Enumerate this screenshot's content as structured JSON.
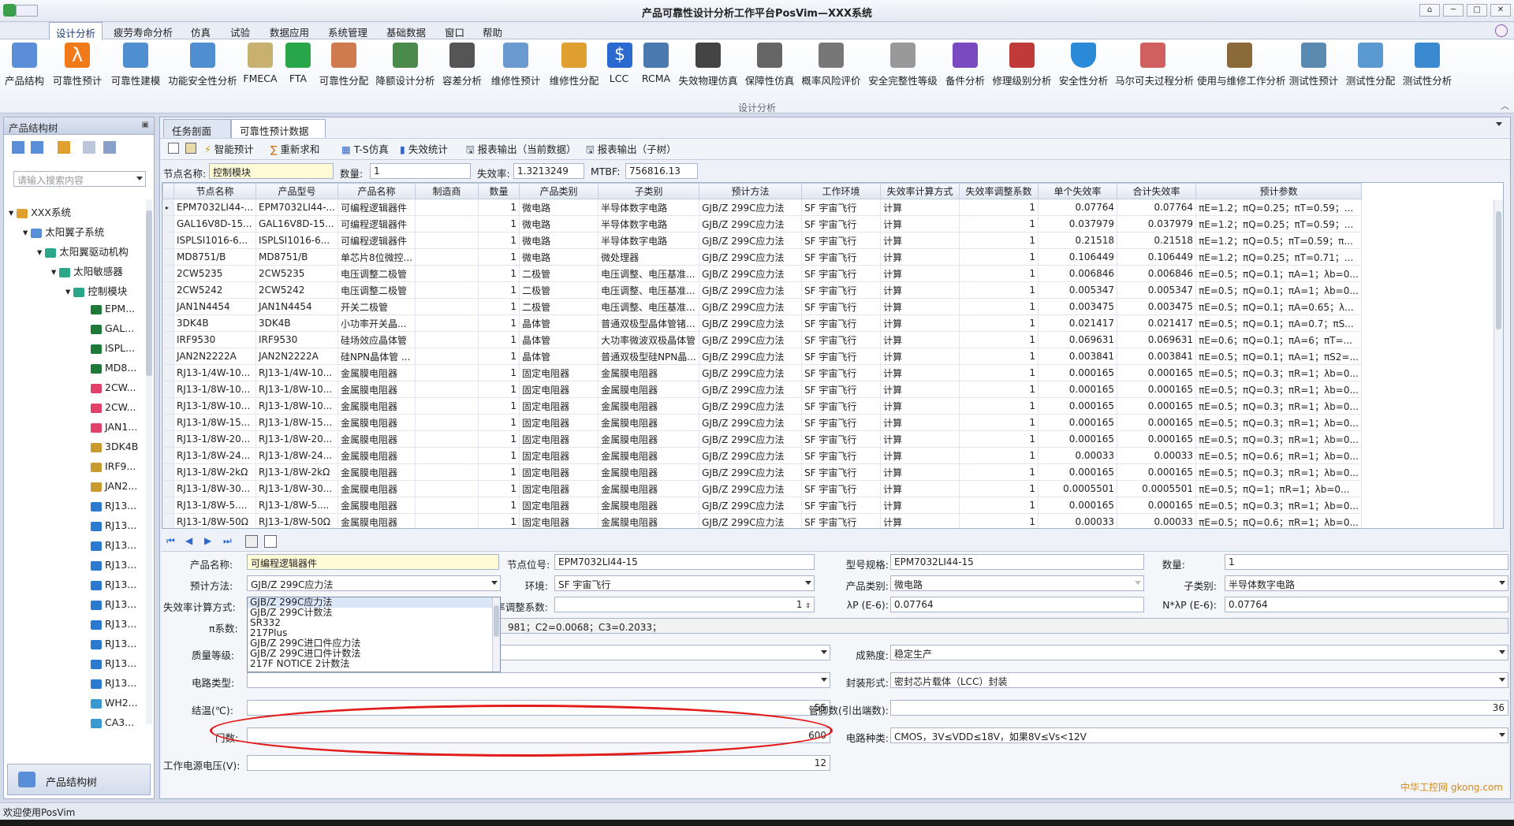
{
  "window": {
    "title": "产品可靠性设计分析工作平台PosVim—XXX系统"
  },
  "menu": [
    "设计分析",
    "疲劳寿命分析",
    "仿真",
    "试验",
    "数据应用",
    "系统管理",
    "基础数据",
    "窗口",
    "帮助"
  ],
  "ribbon": {
    "group": "设计分析",
    "buttons": [
      "产品结构",
      "可靠性预计",
      "可靠性建模",
      "功能安全性分析",
      "FMECA",
      "FTA",
      "可靠性分配",
      "降额设计分析",
      "容差分析",
      "维修性预计",
      "维修性分配",
      "LCC",
      "RCMA",
      "失效物理仿真",
      "保障性仿真",
      "概率风险评价",
      "安全完整性等级",
      "备件分析",
      "修理级别分析",
      "安全性分析",
      "马尔可夫过程分析",
      "使用与维修工作分析",
      "测试性预计",
      "测试性分配",
      "测试性分析"
    ]
  },
  "left_panel": {
    "title": "产品结构树",
    "search_placeholder": "请输入搜索内容",
    "tree": [
      "XXX系统",
      "太阳翼子系统",
      "太阳翼驱动机构",
      "太阳敏感器",
      "控制模块",
      "EPM...",
      "GAL...",
      "ISPL...",
      "MD8...",
      "2CW...",
      "2CW...",
      "JAN1...",
      "3DK4B",
      "IRF9...",
      "JAN2...",
      "RJ13...",
      "RJ13...",
      "RJ13...",
      "RJ13...",
      "RJ13...",
      "RJ13...",
      "RJ13...",
      "RJ13...",
      "RJ13...",
      "RJ13...",
      "WH2...",
      "CA3..."
    ],
    "footer": "产品结构树"
  },
  "tabs": [
    "任务剖面",
    "可靠性预计数据"
  ],
  "toolbar": [
    "智能预计",
    "重新求和",
    "T-S仿真",
    "失效统计",
    "报表输出（当前数据）",
    "报表输出（子树）"
  ],
  "summary": {
    "node_label": "节点名称:",
    "node_value": "控制模块",
    "qty_label": "数量:",
    "qty_value": "1",
    "rate_label": "失效率:",
    "rate_value": "1.3213249",
    "mtbf_label": "MTBF:",
    "mtbf_value": "756816.13"
  },
  "grid": {
    "columns": [
      "节点名称",
      "产品型号",
      "产品名称",
      "制造商",
      "数量",
      "产品类别",
      "子类别",
      "预计方法",
      "工作环境",
      "失效率计算方式",
      "失效率调整系数",
      "单个失效率",
      "合计失效率",
      "预计参数"
    ],
    "rows": [
      [
        "EPM7032LI44-...",
        "EPM7032LI44-...",
        "可编程逻辑器件",
        "",
        "1",
        "微电路",
        "半导体数字电路",
        "GJB/Z 299C应力法",
        "SF 宇宙飞行",
        "计算",
        "1",
        "0.07764",
        "0.07764",
        "πE=1.2；πQ=0.25；πT=0.59；..."
      ],
      [
        "GAL16V8D-15...",
        "GAL16V8D-15...",
        "可编程逻辑器件",
        "",
        "1",
        "微电路",
        "半导体数字电路",
        "GJB/Z 299C应力法",
        "SF 宇宙飞行",
        "计算",
        "1",
        "0.037979",
        "0.037979",
        "πE=1.2；πQ=0.25；πT=0.59；..."
      ],
      [
        "ISPLSI1016-6...",
        "ISPLSI1016-6...",
        "可编程逻辑器件",
        "",
        "1",
        "微电路",
        "半导体数字电路",
        "GJB/Z 299C应力法",
        "SF 宇宙飞行",
        "计算",
        "1",
        "0.21518",
        "0.21518",
        "πE=1.2；πQ=0.5；πT=0.59；π..."
      ],
      [
        "MD8751/B",
        "MD8751/B",
        "单芯片8位微控...",
        "",
        "1",
        "微电路",
        "微处理器",
        "GJB/Z 299C应力法",
        "SF 宇宙飞行",
        "计算",
        "1",
        "0.106449",
        "0.106449",
        "πE=1.2；πQ=0.25；πT=0.71；..."
      ],
      [
        "2CW5235",
        "2CW5235",
        "电压调整二极管",
        "",
        "1",
        "二极管",
        "电压调整、电压基准...",
        "GJB/Z 299C应力法",
        "SF 宇宙飞行",
        "计算",
        "1",
        "0.006846",
        "0.006846",
        "πE=0.5；πQ=0.1；πA=1；λb=0..."
      ],
      [
        "2CW5242",
        "2CW5242",
        "电压调整二极管",
        "",
        "1",
        "二极管",
        "电压调整、电压基准...",
        "GJB/Z 299C应力法",
        "SF 宇宙飞行",
        "计算",
        "1",
        "0.005347",
        "0.005347",
        "πE=0.5；πQ=0.1；πA=1；λb=0..."
      ],
      [
        "JAN1N4454",
        "JAN1N4454",
        "开关二极管",
        "",
        "1",
        "二极管",
        "电压调整、电压基准...",
        "GJB/Z 299C应力法",
        "SF 宇宙飞行",
        "计算",
        "1",
        "0.003475",
        "0.003475",
        "πE=0.5；πQ=0.1；πA=0.65；λ..."
      ],
      [
        "3DK4B",
        "3DK4B",
        "小功率开关晶...",
        "",
        "1",
        "晶体管",
        "普通双极型晶体管锗...",
        "GJB/Z 299C应力法",
        "SF 宇宙飞行",
        "计算",
        "1",
        "0.021417",
        "0.021417",
        "πE=0.5；πQ=0.1；πA=0.7；πS..."
      ],
      [
        "IRF9530",
        "IRF9530",
        "硅场效应晶体管",
        "",
        "1",
        "晶体管",
        "大功率微波双极晶体管",
        "GJB/Z 299C应力法",
        "SF 宇宙飞行",
        "计算",
        "1",
        "0.069631",
        "0.069631",
        "πE=0.6；πQ=0.1；πA=6；πT=..."
      ],
      [
        "JAN2N2222A",
        "JAN2N2222A",
        "硅NPN晶体管 ...",
        "",
        "1",
        "晶体管",
        "普通双极型硅NPN晶...",
        "GJB/Z 299C应力法",
        "SF 宇宙飞行",
        "计算",
        "1",
        "0.003841",
        "0.003841",
        "πE=0.5；πQ=0.1；πA=1；πS2=..."
      ],
      [
        "RJ13-1/4W-10...",
        "RJ13-1/4W-10...",
        "金属膜电阻器",
        "",
        "1",
        "固定电阻器",
        "金属膜电阻器",
        "GJB/Z 299C应力法",
        "SF 宇宙飞行",
        "计算",
        "1",
        "0.000165",
        "0.000165",
        "πE=0.5；πQ=0.3；πR=1；λb=0..."
      ],
      [
        "RJ13-1/8W-10...",
        "RJ13-1/8W-10...",
        "金属膜电阻器",
        "",
        "1",
        "固定电阻器",
        "金属膜电阻器",
        "GJB/Z 299C应力法",
        "SF 宇宙飞行",
        "计算",
        "1",
        "0.000165",
        "0.000165",
        "πE=0.5；πQ=0.3；πR=1；λb=0..."
      ],
      [
        "RJ13-1/8W-10...",
        "RJ13-1/8W-10...",
        "金属膜电阻器",
        "",
        "1",
        "固定电阻器",
        "金属膜电阻器",
        "GJB/Z 299C应力法",
        "SF 宇宙飞行",
        "计算",
        "1",
        "0.000165",
        "0.000165",
        "πE=0.5；πQ=0.3；πR=1；λb=0..."
      ],
      [
        "RJ13-1/8W-15...",
        "RJ13-1/8W-15...",
        "金属膜电阻器",
        "",
        "1",
        "固定电阻器",
        "金属膜电阻器",
        "GJB/Z 299C应力法",
        "SF 宇宙飞行",
        "计算",
        "1",
        "0.000165",
        "0.000165",
        "πE=0.5；πQ=0.3；πR=1；λb=0..."
      ],
      [
        "RJ13-1/8W-20...",
        "RJ13-1/8W-20...",
        "金属膜电阻器",
        "",
        "1",
        "固定电阻器",
        "金属膜电阻器",
        "GJB/Z 299C应力法",
        "SF 宇宙飞行",
        "计算",
        "1",
        "0.000165",
        "0.000165",
        "πE=0.5；πQ=0.3；πR=1；λb=0..."
      ],
      [
        "RJ13-1/8W-24...",
        "RJ13-1/8W-24...",
        "金属膜电阻器",
        "",
        "1",
        "固定电阻器",
        "金属膜电阻器",
        "GJB/Z 299C应力法",
        "SF 宇宙飞行",
        "计算",
        "1",
        "0.00033",
        "0.00033",
        "πE=0.5；πQ=0.6；πR=1；λb=0..."
      ],
      [
        "RJ13-1/8W-2kΩ",
        "RJ13-1/8W-2kΩ",
        "金属膜电阻器",
        "",
        "1",
        "固定电阻器",
        "金属膜电阻器",
        "GJB/Z 299C应力法",
        "SF 宇宙飞行",
        "计算",
        "1",
        "0.000165",
        "0.000165",
        "πE=0.5；πQ=0.3；πR=1；λb=0..."
      ],
      [
        "RJ13-1/8W-30...",
        "RJ13-1/8W-30...",
        "金属膜电阻器",
        "",
        "1",
        "固定电阻器",
        "金属膜电阻器",
        "GJB/Z 299C应力法",
        "SF 宇宙飞行",
        "计算",
        "1",
        "0.0005501",
        "0.0005501",
        "πE=0.5；πQ=1；πR=1；λb=0..."
      ],
      [
        "RJ13-1/8W-5....",
        "RJ13-1/8W-5....",
        "金属膜电阻器",
        "",
        "1",
        "固定电阻器",
        "金属膜电阻器",
        "GJB/Z 299C应力法",
        "SF 宇宙飞行",
        "计算",
        "1",
        "0.000165",
        "0.000165",
        "πE=0.5；πQ=0.3；πR=1；λb=0..."
      ],
      [
        "RJ13-1/8W-50Ω",
        "RJ13-1/8W-50Ω",
        "金属膜电阻器",
        "",
        "1",
        "固定电阻器",
        "金属膜电阻器",
        "GJB/Z 299C应力法",
        "SF 宇宙飞行",
        "计算",
        "1",
        "0.00033",
        "0.00033",
        "πE=0.5；πQ=0.6；πR=1；λb=0..."
      ]
    ]
  },
  "detail": {
    "product_name_label": "产品名称:",
    "product_name": "可编程逻辑器件",
    "node_code_label": "节点位号:",
    "node_code": "EPM7032LI44-15",
    "spec_label": "型号规格:",
    "spec": "EPM7032LI44-15",
    "qty_label": "数量:",
    "qty": "1",
    "method_label": "预计方法:",
    "method": "GJB/Z 299C应力法",
    "env_label": "环境:",
    "env": "SF 宇宙飞行",
    "category_label": "产品类别:",
    "category": "微电路",
    "subcategory_label": "子类别:",
    "subcategory": "半导体数字电路",
    "calc_label": "失效率计算方式:",
    "adjust_label": "失效率调整系数:",
    "adjust": "1",
    "lambda_label": "λP (E-6):",
    "lambda": "0.07764",
    "nlambda_label": "N*λP (E-6):",
    "nlambda": "0.07764",
    "pi_label": "π系数:",
    "pi_tail": "981；C2=0.0068；C3=0.2033；",
    "quality_label": "质量等级:",
    "maturity_label": "成熟度:",
    "maturity": "稳定生产",
    "circuit_label": "电路类型:",
    "package_label": "封装形式:",
    "package": "密封芯片载体（LCC）封装",
    "tj_label": "结温(℃):",
    "tj": "55",
    "pins_label": "管脚数(引出端数):",
    "pins": "36",
    "gates_label": "门数:",
    "gates": "600",
    "circuit_kind_label": "电路种类:",
    "circuit_kind": "CMOS，3V≤VDD≤18V，如果8V≤Vs<12V",
    "vcc_label": "工作电源电压(V):",
    "vcc": "12",
    "method_options": [
      "GJB/Z 299C应力法",
      "GJB/Z 299C计数法",
      "SR332",
      "217Plus",
      "GJB/Z 299C进口件应力法",
      "GJB/Z 299C进口件计数法",
      "217F NOTICE 2计数法"
    ]
  },
  "status": "欢迎使用PosVim",
  "watermark": "中华工控网 gkong.com"
}
